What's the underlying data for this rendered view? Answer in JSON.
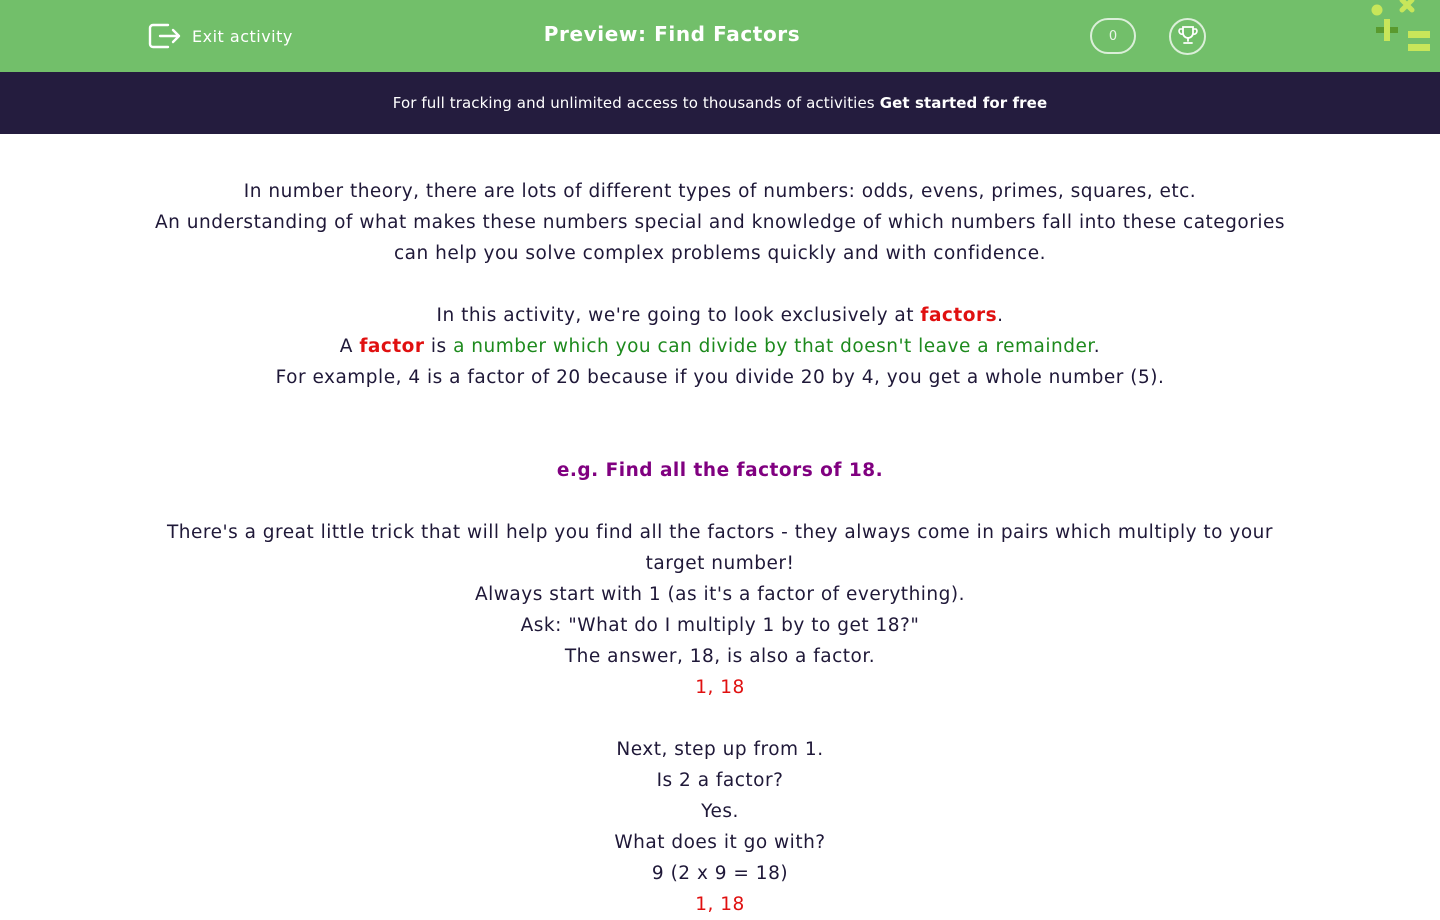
{
  "header": {
    "exit_label": "Exit activity",
    "title": "Preview: Find Factors",
    "score": "0",
    "icons": [
      "exit-icon",
      "trophy-icon",
      "logo-icon"
    ],
    "colors": {
      "bar": "#72bf6a",
      "logo_dark": "#5a9a2e",
      "logo_light": "#c8e65a"
    }
  },
  "promo": {
    "text": "For full tracking and unlimited access to thousands of activities",
    "cta": "Get started for free",
    "background": "#241c3e"
  },
  "content": {
    "intro1": "In number theory, there are lots of different types of numbers: odds, evens, primes, squares, etc.",
    "intro2": "An understanding of what makes these numbers special and knowledge of which numbers fall into these categories can help you solve complex problems quickly and with confidence.",
    "activity_pre": "In this activity, we're going to look exclusively at ",
    "activity_term": "factors",
    "activity_post": ".",
    "def_pre": "A ",
    "def_term": "factor",
    "def_mid": " is ",
    "def_text": "a number which you can divide by that doesn't leave a remainder",
    "def_post": ".",
    "example": "For example, 4 is a factor of 20 because if you divide 20 by 4, you get a whole number (5).",
    "eg_heading": "e.g. Find all the factors of 18.",
    "trick": "There's a great little trick that will help you find all the factors - they always come in pairs which multiply to your target number!",
    "step1": "Always start with 1 (as it's a factor of everything).",
    "step2": "Ask: \"What do I multiply 1 by to get 18?\"",
    "step3": "The answer, 18, is also a factor.",
    "result1": "1, 18",
    "step4": "Next, step up from 1.",
    "step5": "Is 2 a factor?",
    "step6": "Yes.",
    "step7": "What does it go with?",
    "step8": "9 (2 x 9 = 18)",
    "result2": "1, 18"
  }
}
